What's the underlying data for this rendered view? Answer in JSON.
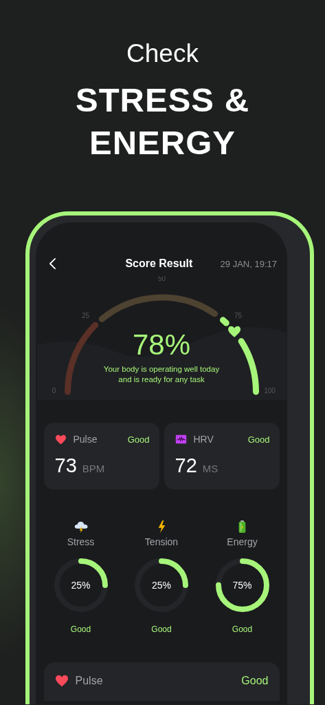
{
  "headline": {
    "title": "Check",
    "lines": [
      "STRESS &",
      "ENERGY"
    ]
  },
  "header": {
    "title": "Score Result",
    "date": "29 JAN, 19:17"
  },
  "gauge": {
    "level": 0.78,
    "value": "78%",
    "message": "Your body is operating well today and is ready for any task",
    "ticks": [
      "0",
      "25",
      "50",
      "75",
      "100"
    ]
  },
  "metrics": [
    {
      "kind": "heart",
      "name": "Pulse",
      "status": "Good",
      "value": "73",
      "unit": "BPM"
    },
    {
      "kind": "hrv",
      "name": "HRV",
      "status": "Good",
      "value": "72",
      "unit": "MS"
    }
  ],
  "rings": [
    {
      "kind": "storm",
      "name": "Stress",
      "level": 0.25,
      "value": "25%",
      "status": "Good"
    },
    {
      "kind": "bolt",
      "name": "Tension",
      "level": 0.25,
      "value": "25%",
      "status": "Good"
    },
    {
      "kind": "battery",
      "name": "Energy",
      "level": 0.75,
      "value": "75%",
      "status": "Good"
    }
  ],
  "detail_card": {
    "kind": "heart",
    "name": "Pulse",
    "status": "Good"
  }
}
